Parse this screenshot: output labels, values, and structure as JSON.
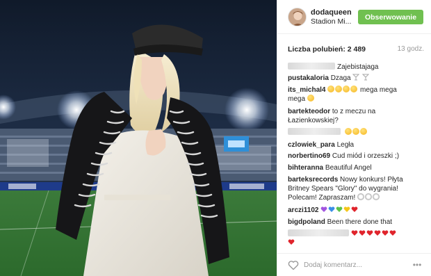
{
  "post": {
    "username": "dodaqueen",
    "location": "Stadion Mi...",
    "follow_label": "Obserwowanie",
    "likes": "Liczba polubień: 2 489",
    "time_ago": "13 godz.",
    "comment_placeholder": "Dodaj komentarz...",
    "more_label": "•••"
  },
  "comments": [
    {
      "user": "",
      "text": "Zajebistajaga",
      "blurred": true
    },
    {
      "user": "pustakaloria",
      "text": "Dzaga"
    },
    {
      "user": "its_michal4",
      "text": "mega mega"
    },
    {
      "text_cont": "mega"
    },
    {
      "user": "bartekteodor",
      "text": "to z meczu na"
    },
    {
      "text_cont": "Łazienkowskiej?"
    },
    {
      "user": "",
      "blurred": true
    },
    {
      "user": "czlowiek_para",
      "text": "Legła"
    },
    {
      "user": "norbertino69",
      "text": "Cud miód i orzeszki ;)"
    },
    {
      "user": "bihteranna",
      "text": "Beautiful Angel"
    },
    {
      "user": "barteksrecords",
      "text": "Nowy konkurs! Płyta"
    },
    {
      "text_cont": "Britney Spears \"Glory\" do wygrania!"
    },
    {
      "text_cont": "Polecam! Zapraszam!"
    },
    {
      "user": "arczi1102",
      "text": ""
    },
    {
      "user": "bigdpoland",
      "text": "Been there done that"
    },
    {
      "user": "",
      "blurred": true
    }
  ],
  "colors": {
    "follow_green": "#70c050",
    "muted": "#999999",
    "text": "#262626",
    "divider": "#efefef"
  },
  "icons": {
    "like": "heart-outline-icon",
    "more": "more-options-icon"
  }
}
